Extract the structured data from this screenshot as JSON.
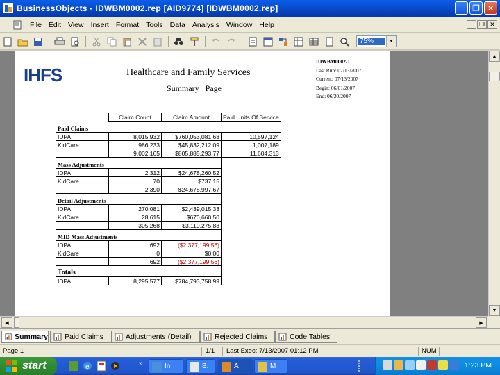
{
  "window": {
    "title": "BusinessObjects - IDWBM0002.rep [AID9774] [IDWBM0002.rep]"
  },
  "menu": {
    "items": [
      "File",
      "Edit",
      "View",
      "Insert",
      "Format",
      "Tools",
      "Data",
      "Analysis",
      "Window",
      "Help"
    ]
  },
  "toolbar": {
    "zoom_value": "75%"
  },
  "report": {
    "logo": "IHFS",
    "title": "Healthcare and Family Services",
    "subtitle": "Summary Page",
    "meta": {
      "id": "IDWBM0002-1",
      "last_run": "Last Run: 07/13/2007",
      "current": "Current: 07/13/2007",
      "begin": "Begin: 06/01/2007",
      "end": "End: 06/30/2007"
    },
    "columns": [
      "Claim Count",
      "Claim Amount",
      "Paid Units Of Service"
    ],
    "sections": [
      {
        "name": "Paid Claims",
        "rows": [
          {
            "label": "IDPA",
            "count": "8,015,932",
            "amount": "$760,053,081.68",
            "units": "10,597,124"
          },
          {
            "label": "KidCare",
            "count": "986,233",
            "amount": "$45,832,212.09",
            "units": "1,007,189"
          }
        ],
        "total": {
          "count": "9,002,165",
          "amount": "$805,885,293.77",
          "units": "11,604,313"
        }
      },
      {
        "name": "Mass Adjustments",
        "rows": [
          {
            "label": "IDPA",
            "count": "2,312",
            "amount": "$24,678,260.52"
          },
          {
            "label": "KidCare",
            "count": "70",
            "amount": "$737.15"
          }
        ],
        "total": {
          "count": "2,390",
          "amount": "$24,678,997.67"
        }
      },
      {
        "name": "Detail Adjustments",
        "rows": [
          {
            "label": "IDPA",
            "count": "270,081",
            "amount": "$2,439,015.33"
          },
          {
            "label": "KidCare",
            "count": "28,615",
            "amount": "$670,660.50"
          }
        ],
        "total": {
          "count": "305,268",
          "amount": "$3,110,275.83"
        }
      },
      {
        "name": "MID Mass Adjustments",
        "rows": [
          {
            "label": "IDPA",
            "count": "692",
            "amount": "($2,377,199.56)",
            "negative": true
          },
          {
            "label": "KidCare",
            "count": "0",
            "amount": "$0.00"
          }
        ],
        "total": {
          "count": "692",
          "amount": "($2,377,199.56)",
          "negative": true
        }
      }
    ],
    "totals": {
      "name": "Totals",
      "rows": [
        {
          "label": "IDPA",
          "count": "8,295,577",
          "amount": "$784,793,758.99"
        }
      ]
    },
    "colors": {
      "negative": "#c00000",
      "logo": "#1b3f8f"
    }
  },
  "tabs": [
    "Summary",
    "Paid Claims",
    "Adjustments (Detail)",
    "Rejected Claims",
    "Code Tables"
  ],
  "status": {
    "page": "Page 1",
    "page_count": "1/1",
    "last_exec": "Last Exec: 7/13/2007 01:12 PM",
    "num": "NUM"
  },
  "taskbar": {
    "start_label": "start",
    "tasks": [
      "In",
      "B.",
      "A",
      "M"
    ],
    "clock": "1:23 PM"
  }
}
